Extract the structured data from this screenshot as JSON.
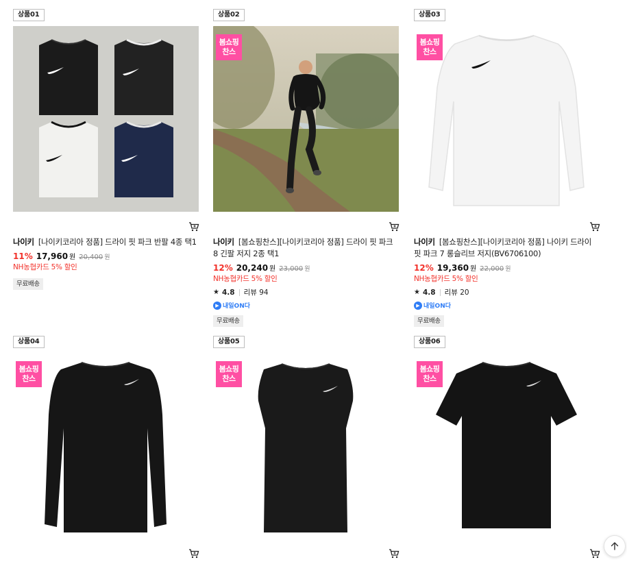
{
  "products": [
    {
      "rank": "상품01",
      "event_badge": "",
      "brand": "나이키",
      "name": "[나이키코리아 정품] 드라이 핏 파크 반팔 4종 택1",
      "discount": "11%",
      "price": "17,960",
      "price_unit": "원",
      "original_price": "20,400",
      "original_unit": "원",
      "promo": "NH농협카드 5% 할인",
      "rating": "",
      "review_label": "",
      "tomorrow_badge": "",
      "shipping": "무료배송",
      "image": "four-folded-nike-tees"
    },
    {
      "rank": "상품02",
      "event_badge": "봄쇼핑찬스",
      "brand": "나이키",
      "name": "[봄쇼핑찬스][나이키코리아 정품] 드라이 핏 파크 8 긴팔 저지 2종 택1",
      "discount": "12%",
      "price": "20,240",
      "price_unit": "원",
      "original_price": "23,000",
      "original_unit": "원",
      "promo": "NH농협카드 5% 할인",
      "rating": "4.8",
      "review_label": "리뷰 94",
      "tomorrow_badge": "내일ON다",
      "shipping": "무료배송",
      "image": "runner-by-river"
    },
    {
      "rank": "상품03",
      "event_badge": "봄쇼핑찬스",
      "brand": "나이키",
      "name": "[봄쇼핑찬스][나이키코리아 정품] 나이키 드라이 핏 파크 7 롱슬리브 저지(BV6706100)",
      "discount": "12%",
      "price": "19,360",
      "price_unit": "원",
      "original_price": "22,000",
      "original_unit": "원",
      "promo": "NH농협카드 5% 할인",
      "rating": "4.8",
      "review_label": "리뷰 20",
      "tomorrow_badge": "내일ON다",
      "shipping": "무료배송",
      "image": "white-longsleeve"
    },
    {
      "rank": "상품04",
      "event_badge": "봄쇼핑찬스",
      "image": "black-longsleeve"
    },
    {
      "rank": "상품05",
      "event_badge": "봄쇼핑찬스",
      "image": "black-sleeveless"
    },
    {
      "rank": "상품06",
      "event_badge": "봄쇼핑찬스",
      "image": "black-tee"
    }
  ],
  "icons": {
    "cart": "cart-icon",
    "star": "star-icon",
    "scroll_top": "arrow-up-icon"
  },
  "colors": {
    "discount_red": "#f2312a",
    "event_pink": "#ff4fa3",
    "delivery_blue": "#2f7df6"
  }
}
